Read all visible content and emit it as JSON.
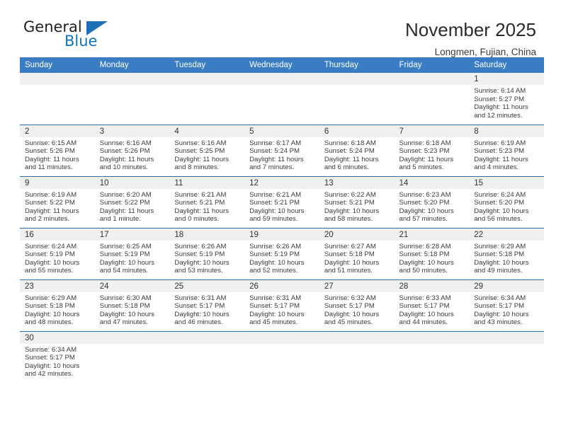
{
  "brand": {
    "name_top": "General",
    "name_bottom": "Blue",
    "triangle_icon": "triangle-icon",
    "color_black": "#231f20",
    "color_blue": "#1274bd"
  },
  "header": {
    "title": "November 2025",
    "subtitle": "Longmen, Fujian, China"
  },
  "theme": {
    "header_blue": "#3b7dc4",
    "row_border_blue": "#2e6da4",
    "daynum_band": "#f0f0f0"
  },
  "calendar": {
    "weekday_headers": [
      "Sunday",
      "Monday",
      "Tuesday",
      "Wednesday",
      "Thursday",
      "Friday",
      "Saturday"
    ],
    "weeks": [
      [
        {
          "day": "",
          "lines": []
        },
        {
          "day": "",
          "lines": []
        },
        {
          "day": "",
          "lines": []
        },
        {
          "day": "",
          "lines": []
        },
        {
          "day": "",
          "lines": []
        },
        {
          "day": "",
          "lines": []
        },
        {
          "day": "1",
          "lines": [
            "Sunrise: 6:14 AM",
            "Sunset: 5:27 PM",
            "Daylight: 11 hours",
            "and 12 minutes."
          ]
        }
      ],
      [
        {
          "day": "2",
          "lines": [
            "Sunrise: 6:15 AM",
            "Sunset: 5:26 PM",
            "Daylight: 11 hours",
            "and 11 minutes."
          ]
        },
        {
          "day": "3",
          "lines": [
            "Sunrise: 6:16 AM",
            "Sunset: 5:26 PM",
            "Daylight: 11 hours",
            "and 10 minutes."
          ]
        },
        {
          "day": "4",
          "lines": [
            "Sunrise: 6:16 AM",
            "Sunset: 5:25 PM",
            "Daylight: 11 hours",
            "and 8 minutes."
          ]
        },
        {
          "day": "5",
          "lines": [
            "Sunrise: 6:17 AM",
            "Sunset: 5:24 PM",
            "Daylight: 11 hours",
            "and 7 minutes."
          ]
        },
        {
          "day": "6",
          "lines": [
            "Sunrise: 6:18 AM",
            "Sunset: 5:24 PM",
            "Daylight: 11 hours",
            "and 6 minutes."
          ]
        },
        {
          "day": "7",
          "lines": [
            "Sunrise: 6:18 AM",
            "Sunset: 5:23 PM",
            "Daylight: 11 hours",
            "and 5 minutes."
          ]
        },
        {
          "day": "8",
          "lines": [
            "Sunrise: 6:19 AM",
            "Sunset: 5:23 PM",
            "Daylight: 11 hours",
            "and 4 minutes."
          ]
        }
      ],
      [
        {
          "day": "9",
          "lines": [
            "Sunrise: 6:19 AM",
            "Sunset: 5:22 PM",
            "Daylight: 11 hours",
            "and 2 minutes."
          ]
        },
        {
          "day": "10",
          "lines": [
            "Sunrise: 6:20 AM",
            "Sunset: 5:22 PM",
            "Daylight: 11 hours",
            "and 1 minute."
          ]
        },
        {
          "day": "11",
          "lines": [
            "Sunrise: 6:21 AM",
            "Sunset: 5:21 PM",
            "Daylight: 11 hours",
            "and 0 minutes."
          ]
        },
        {
          "day": "12",
          "lines": [
            "Sunrise: 6:21 AM",
            "Sunset: 5:21 PM",
            "Daylight: 10 hours",
            "and 59 minutes."
          ]
        },
        {
          "day": "13",
          "lines": [
            "Sunrise: 6:22 AM",
            "Sunset: 5:21 PM",
            "Daylight: 10 hours",
            "and 58 minutes."
          ]
        },
        {
          "day": "14",
          "lines": [
            "Sunrise: 6:23 AM",
            "Sunset: 5:20 PM",
            "Daylight: 10 hours",
            "and 57 minutes."
          ]
        },
        {
          "day": "15",
          "lines": [
            "Sunrise: 6:24 AM",
            "Sunset: 5:20 PM",
            "Daylight: 10 hours",
            "and 56 minutes."
          ]
        }
      ],
      [
        {
          "day": "16",
          "lines": [
            "Sunrise: 6:24 AM",
            "Sunset: 5:19 PM",
            "Daylight: 10 hours",
            "and 55 minutes."
          ]
        },
        {
          "day": "17",
          "lines": [
            "Sunrise: 6:25 AM",
            "Sunset: 5:19 PM",
            "Daylight: 10 hours",
            "and 54 minutes."
          ]
        },
        {
          "day": "18",
          "lines": [
            "Sunrise: 6:26 AM",
            "Sunset: 5:19 PM",
            "Daylight: 10 hours",
            "and 53 minutes."
          ]
        },
        {
          "day": "19",
          "lines": [
            "Sunrise: 6:26 AM",
            "Sunset: 5:19 PM",
            "Daylight: 10 hours",
            "and 52 minutes."
          ]
        },
        {
          "day": "20",
          "lines": [
            "Sunrise: 6:27 AM",
            "Sunset: 5:18 PM",
            "Daylight: 10 hours",
            "and 51 minutes."
          ]
        },
        {
          "day": "21",
          "lines": [
            "Sunrise: 6:28 AM",
            "Sunset: 5:18 PM",
            "Daylight: 10 hours",
            "and 50 minutes."
          ]
        },
        {
          "day": "22",
          "lines": [
            "Sunrise: 6:29 AM",
            "Sunset: 5:18 PM",
            "Daylight: 10 hours",
            "and 49 minutes."
          ]
        }
      ],
      [
        {
          "day": "23",
          "lines": [
            "Sunrise: 6:29 AM",
            "Sunset: 5:18 PM",
            "Daylight: 10 hours",
            "and 48 minutes."
          ]
        },
        {
          "day": "24",
          "lines": [
            "Sunrise: 6:30 AM",
            "Sunset: 5:18 PM",
            "Daylight: 10 hours",
            "and 47 minutes."
          ]
        },
        {
          "day": "25",
          "lines": [
            "Sunrise: 6:31 AM",
            "Sunset: 5:17 PM",
            "Daylight: 10 hours",
            "and 46 minutes."
          ]
        },
        {
          "day": "26",
          "lines": [
            "Sunrise: 6:31 AM",
            "Sunset: 5:17 PM",
            "Daylight: 10 hours",
            "and 45 minutes."
          ]
        },
        {
          "day": "27",
          "lines": [
            "Sunrise: 6:32 AM",
            "Sunset: 5:17 PM",
            "Daylight: 10 hours",
            "and 45 minutes."
          ]
        },
        {
          "day": "28",
          "lines": [
            "Sunrise: 6:33 AM",
            "Sunset: 5:17 PM",
            "Daylight: 10 hours",
            "and 44 minutes."
          ]
        },
        {
          "day": "29",
          "lines": [
            "Sunrise: 6:34 AM",
            "Sunset: 5:17 PM",
            "Daylight: 10 hours",
            "and 43 minutes."
          ]
        }
      ],
      [
        {
          "day": "30",
          "lines": [
            "Sunrise: 6:34 AM",
            "Sunset: 5:17 PM",
            "Daylight: 10 hours",
            "and 42 minutes."
          ]
        },
        {
          "day": "",
          "lines": []
        },
        {
          "day": "",
          "lines": []
        },
        {
          "day": "",
          "lines": []
        },
        {
          "day": "",
          "lines": []
        },
        {
          "day": "",
          "lines": []
        },
        {
          "day": "",
          "lines": []
        }
      ]
    ]
  }
}
